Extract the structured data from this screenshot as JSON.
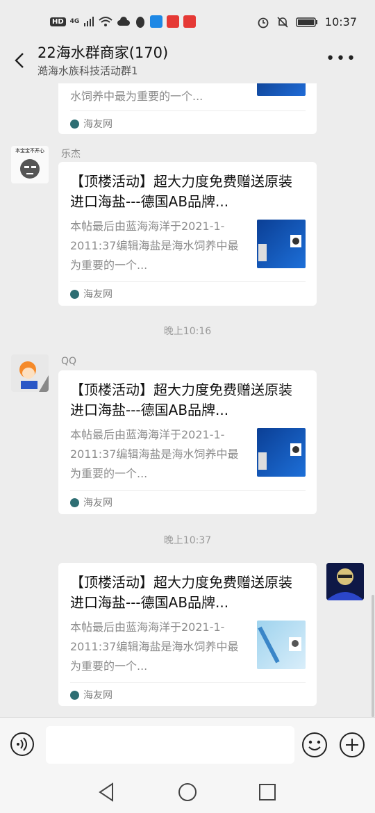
{
  "status_bar": {
    "hd_label": "HD",
    "network_label": "4G",
    "time": "10:37",
    "icons": [
      "signal-icon",
      "wifi-icon",
      "cloud-icon",
      "penguin-icon",
      "app-icon",
      "app-icon",
      "app-icon",
      "alarm-icon",
      "mute-icon",
      "battery-icon"
    ]
  },
  "header": {
    "title": "22海水群商家(170)",
    "subtitle": "澔海水族科技活动群1",
    "more_label": "•••"
  },
  "messages": [
    {
      "type": "card-partial",
      "desc_tail": "水饲养中最为重要的一个...",
      "source": "海友网"
    },
    {
      "type": "card",
      "sender": "乐杰",
      "avatar_text": "本宝宝不开心",
      "title": "【顶楼活动】超大力度免费赠送原装进口海盐---德国AB品牌...",
      "desc": "本帖最后由蓝海海洋于2021-1-2011:37编辑海盐是海水饲养中最为重要的一个...",
      "source": "海友网"
    },
    {
      "type": "time",
      "text": "晚上10:16"
    },
    {
      "type": "card",
      "sender": "QQ",
      "title": "【顶楼活动】超大力度免费赠送原装进口海盐---德国AB品牌...",
      "desc": "本帖最后由蓝海海洋于2021-1-2011:37编辑海盐是海水饲养中最为重要的一个...",
      "source": "海友网"
    },
    {
      "type": "time",
      "text": "晚上10:37"
    },
    {
      "type": "card-self",
      "title": "【顶楼活动】超大力度免费赠送原装进口海盐---德国AB品牌...",
      "desc": "本帖最后由蓝海海洋于2021-1-2011:37编辑海盐是海水饲养中最为重要的一个...",
      "source": "海友网"
    }
  ],
  "input_bar": {
    "input_value": "",
    "icons": [
      "voice-icon",
      "emoji-icon",
      "plus-icon"
    ]
  },
  "nav_bar": {
    "icons": [
      "back-triangle-icon",
      "home-circle-icon",
      "recents-square-icon"
    ]
  },
  "colors": {
    "background": "#ededed",
    "card": "#ffffff",
    "meta_text": "#8c8c8c",
    "source_icon": "#2e6e73"
  }
}
